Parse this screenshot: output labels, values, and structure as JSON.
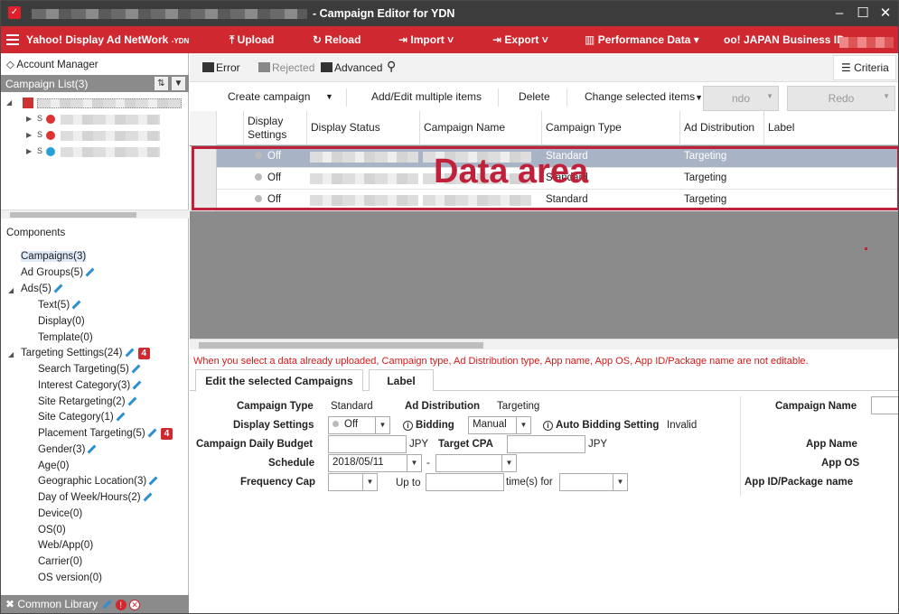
{
  "window": {
    "title": "- Campaign Editor for YDN",
    "logo": "ydn-logo-icon"
  },
  "menubar": {
    "brand": "Yahoo! Display Ad NetWork",
    "brand_suffix": "-YDN",
    "upload": "Upload",
    "reload": "Reload",
    "import": "Import",
    "export": "Export",
    "performance": "Performance Data",
    "business_id": "oo! JAPAN Business ID :"
  },
  "left": {
    "account_manager": "Account Manager",
    "campaign_list": "Campaign List(3)",
    "components_title": "Components",
    "components": [
      {
        "label": "Campaigns(3)",
        "badge": ""
      },
      {
        "label": "Ad Groups(5)",
        "badge": ""
      },
      {
        "label": "Ads(5)",
        "badge": ""
      },
      {
        "label": "Text(5)",
        "badge": ""
      },
      {
        "label": "Display(0)",
        "badge": ""
      },
      {
        "label": "Template(0)",
        "badge": ""
      },
      {
        "label": "Targeting Settings(24)",
        "badge": "4"
      },
      {
        "label": "Search Targeting(5)",
        "badge": ""
      },
      {
        "label": "Interest Category(3)",
        "badge": ""
      },
      {
        "label": "Site Retargeting(2)",
        "badge": ""
      },
      {
        "label": "Site Category(1)",
        "badge": ""
      },
      {
        "label": "Placement Targeting(5)",
        "badge": "4"
      },
      {
        "label": "Gender(3)",
        "badge": ""
      },
      {
        "label": "Age(0)",
        "badge": ""
      },
      {
        "label": "Geographic Location(3)",
        "badge": ""
      },
      {
        "label": "Day of Week/Hours(2)",
        "badge": ""
      },
      {
        "label": "Device(0)",
        "badge": ""
      },
      {
        "label": "OS(0)",
        "badge": ""
      },
      {
        "label": "Web/App(0)",
        "badge": ""
      },
      {
        "label": "Carrier(0)",
        "badge": ""
      },
      {
        "label": "OS version(0)",
        "badge": ""
      }
    ],
    "common_library": "Common Library"
  },
  "filters": {
    "error": "Error",
    "rejected": "Rejected",
    "advanced": "Advanced",
    "criteria": "Criteria"
  },
  "toolbar": {
    "create": "Create campaign",
    "add_edit": "Add/Edit multiple items",
    "delete": "Delete",
    "change": "Change selected items",
    "undo": "ndo",
    "redo": "Redo"
  },
  "grid": {
    "columns": [
      "Display Settings",
      "Display Status",
      "Campaign Name",
      "Campaign Type",
      "Ad Distribution",
      "Label"
    ],
    "rows": [
      {
        "display": "Off",
        "type": "Standard",
        "distribution": "Targeting"
      },
      {
        "display": "Off",
        "type": "Standard",
        "distribution": "Targeting"
      },
      {
        "display": "Off",
        "type": "Standard",
        "distribution": "Targeting"
      }
    ],
    "data_area_label": "Data area"
  },
  "note": "When you select a data already uploaded, Campaign type, Ad Distribution type, App name, App OS, App ID/Package name are not editable.",
  "tabs": {
    "edit": "Edit the selected Campaigns",
    "label": "Label"
  },
  "form": {
    "campaign_type_label": "Campaign Type",
    "campaign_type_value": "Standard",
    "ad_distribution_label": "Ad Distribution",
    "ad_distribution_value": "Targeting",
    "display_settings_label": "Display Settings",
    "display_settings_value": "Off",
    "bidding_label": "Bidding",
    "bidding_value": "Manual",
    "auto_bidding_label": "Auto Bidding Setting",
    "auto_bidding_value": "Invalid",
    "budget_label": "Campaign Daily Budget",
    "jpy1": "JPY",
    "target_cpa_label": "Target CPA",
    "jpy2": "JPY",
    "schedule_label": "Schedule",
    "schedule_start": "2018/05/11",
    "dash": "-",
    "frequency_label": "Frequency Cap",
    "up_to": "Up to",
    "times_for": "time(s) for",
    "campaign_name_label": "Campaign Name",
    "app_name_label": "App Name",
    "app_os_label": "App OS",
    "app_id_label": "App ID/Package name"
  },
  "colors": {
    "brand_red": "#cf2830",
    "titlebar": "#3c3c3c",
    "panel_gray": "#8b8b8b",
    "highlight": "#c0213a"
  }
}
